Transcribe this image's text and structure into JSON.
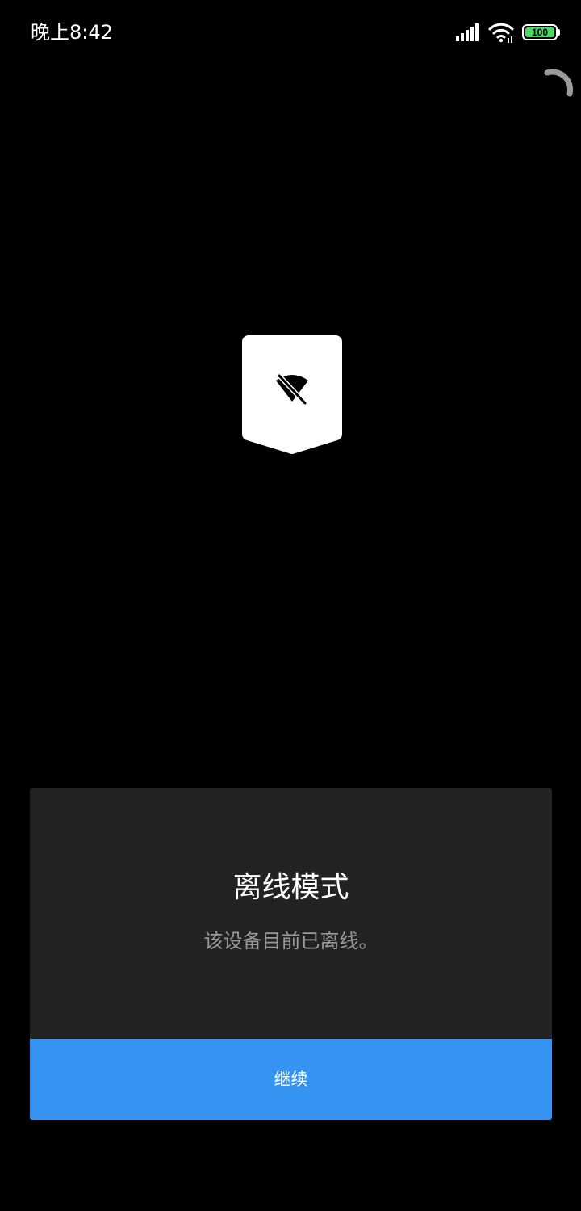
{
  "status_bar": {
    "time": "晚上8:42",
    "battery_level": "100",
    "signal_icon": "signal-bars-icon",
    "wifi_icon": "wifi-icon"
  },
  "spinner_icon": "loading-spinner-icon",
  "badge": {
    "icon": "wifi-off-icon"
  },
  "dialog": {
    "title": "离线模式",
    "message": "该设备目前已离线。",
    "continue_label": "继续"
  },
  "colors": {
    "background": "#000000",
    "card": "#222222",
    "accent": "#3593f2",
    "battery": "#4cd964",
    "muted_text": "#9a9a9a"
  }
}
